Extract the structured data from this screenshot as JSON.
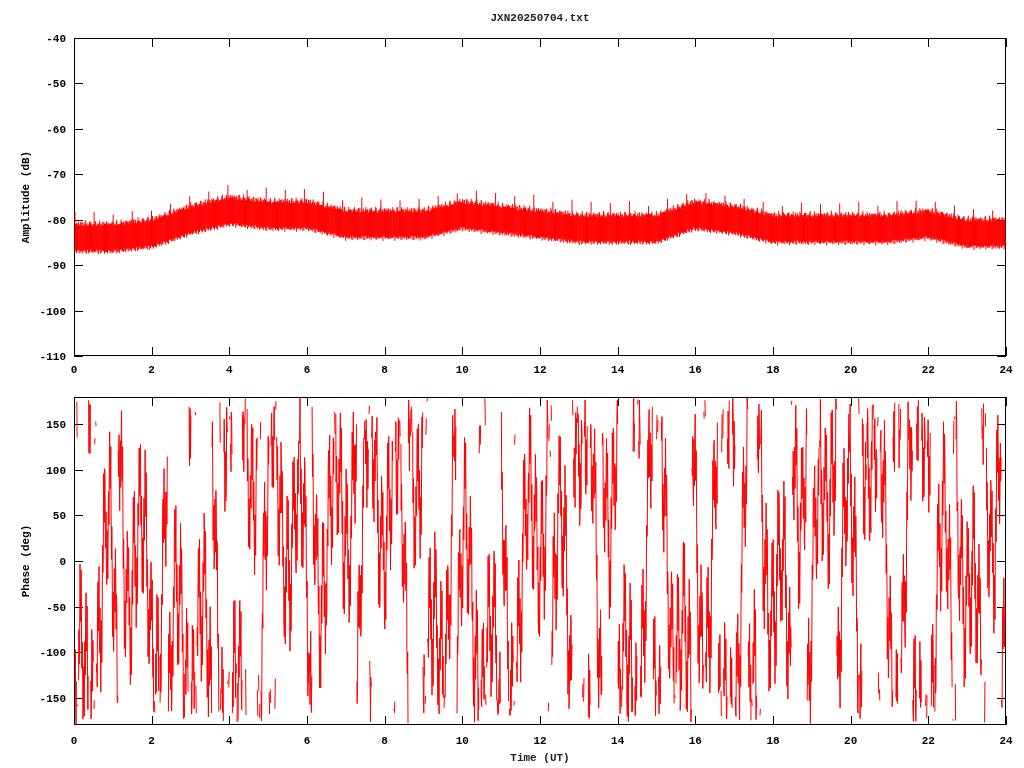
{
  "title": "JXN20250704.txt",
  "amplitude_plot": {
    "ylabel": "Amplitude (dB)",
    "y_tick_labels": [
      "-40",
      "-50",
      "-60",
      "-70",
      "-80",
      "-90",
      "-100",
      "-110"
    ],
    "x_tick_labels": [
      "0",
      "2",
      "4",
      "6",
      "8",
      "10",
      "12",
      "14",
      "16",
      "18",
      "20",
      "22",
      "24"
    ]
  },
  "phase_plot": {
    "ylabel": "Phase (deg)",
    "xlabel": "Time (UT)",
    "y_tick_labels": [
      "150",
      "100",
      "50",
      "0",
      "-50",
      "-100",
      "-150"
    ],
    "x_tick_labels": [
      "0",
      "2",
      "4",
      "6",
      "8",
      "10",
      "12",
      "14",
      "16",
      "18",
      "20",
      "22",
      "24"
    ]
  }
}
